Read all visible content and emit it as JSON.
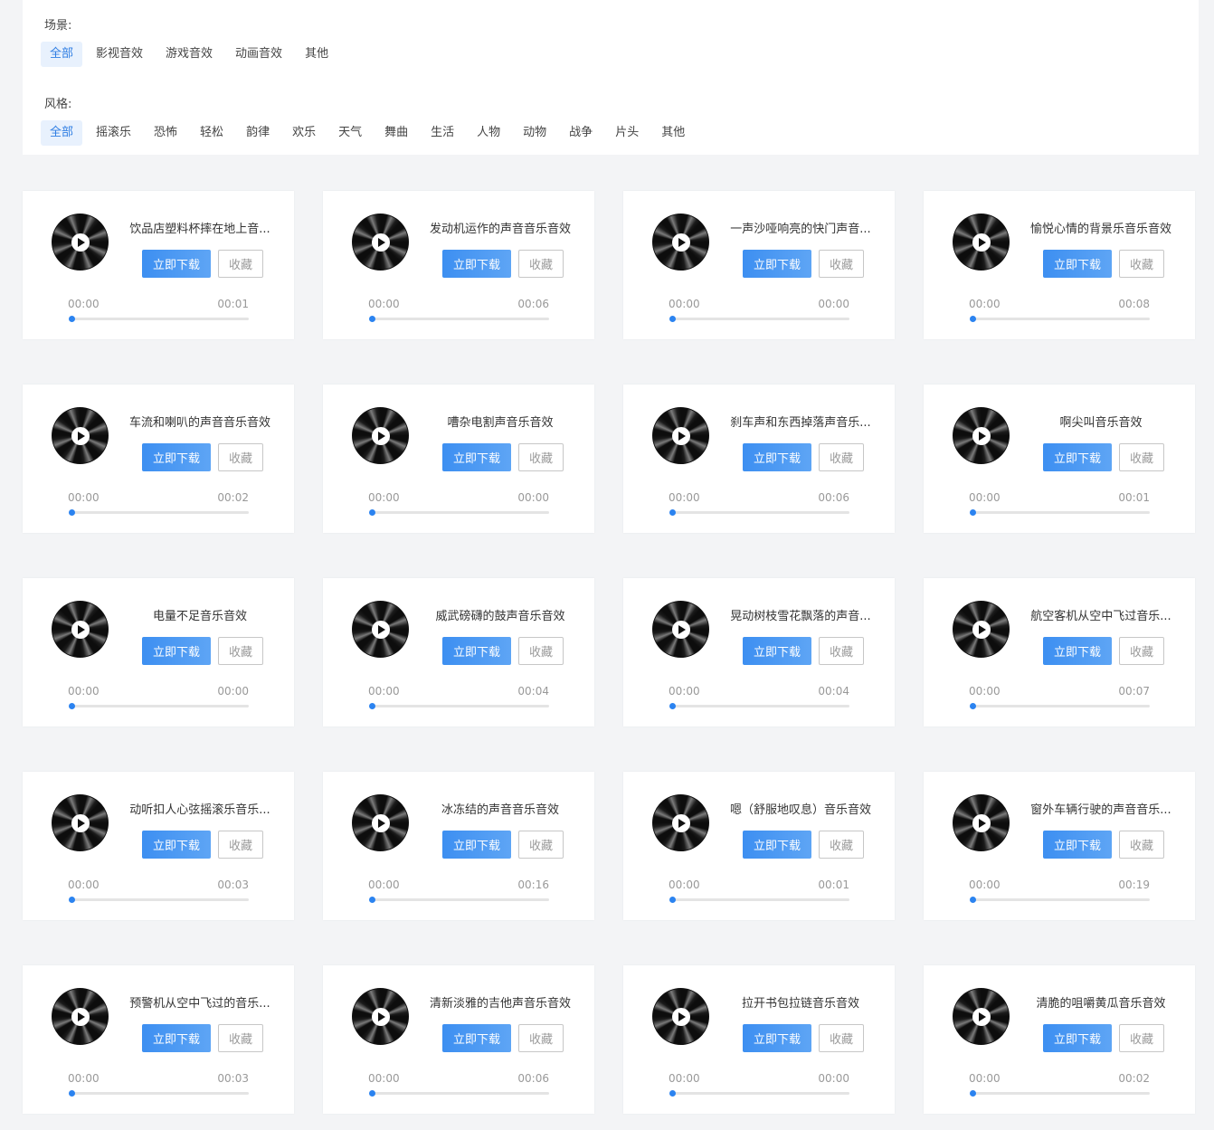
{
  "filters": {
    "scene": {
      "label": "场景:",
      "options": [
        "全部",
        "影视音效",
        "游戏音效",
        "动画音效",
        "其他"
      ],
      "selected": "全部"
    },
    "style": {
      "label": "风格:",
      "options": [
        "全部",
        "摇滚乐",
        "恐怖",
        "轻松",
        "韵律",
        "欢乐",
        "天气",
        "舞曲",
        "生活",
        "人物",
        "动物",
        "战争",
        "片头",
        "其他"
      ],
      "selected": "全部"
    }
  },
  "card_labels": {
    "download": "立即下载",
    "favorite": "收藏",
    "current_time": "00:00"
  },
  "colors": {
    "accent": "#3d8ff1",
    "active_chip_bg": "#e8f1fd",
    "progress_knob": "#2b83f0"
  },
  "sounds": [
    {
      "title": "饮品店塑料杯摔在地上音...",
      "duration": "00:01"
    },
    {
      "title": "发动机运作的声音音乐音效",
      "duration": "00:06"
    },
    {
      "title": "一声沙哑响亮的快门声音...",
      "duration": "00:00"
    },
    {
      "title": "愉悦心情的背景乐音乐音效",
      "duration": "00:08"
    },
    {
      "title": "车流和喇叭的声音音乐音效",
      "duration": "00:02"
    },
    {
      "title": "嘈杂电割声音乐音效",
      "duration": "00:00"
    },
    {
      "title": "刹车声和东西掉落声音乐...",
      "duration": "00:06"
    },
    {
      "title": "啊尖叫音乐音效",
      "duration": "00:01"
    },
    {
      "title": "电量不足音乐音效",
      "duration": "00:00"
    },
    {
      "title": "威武磅礴的鼓声音乐音效",
      "duration": "00:04"
    },
    {
      "title": "晃动树枝雪花飘落的声音...",
      "duration": "00:04"
    },
    {
      "title": "航空客机从空中飞过音乐...",
      "duration": "00:07"
    },
    {
      "title": "动听扣人心弦摇滚乐音乐...",
      "duration": "00:03"
    },
    {
      "title": "冰冻结的声音音乐音效",
      "duration": "00:16"
    },
    {
      "title": "嗯（舒服地叹息）音乐音效",
      "duration": "00:01"
    },
    {
      "title": "窗外车辆行驶的声音音乐...",
      "duration": "00:19"
    },
    {
      "title": "预警机从空中飞过的音乐...",
      "duration": "00:03"
    },
    {
      "title": "清新淡雅的吉他声音乐音效",
      "duration": "00:06"
    },
    {
      "title": "拉开书包拉链音乐音效",
      "duration": "00:00"
    },
    {
      "title": "清脆的咀嚼黄瓜音乐音效",
      "duration": "00:02"
    }
  ]
}
